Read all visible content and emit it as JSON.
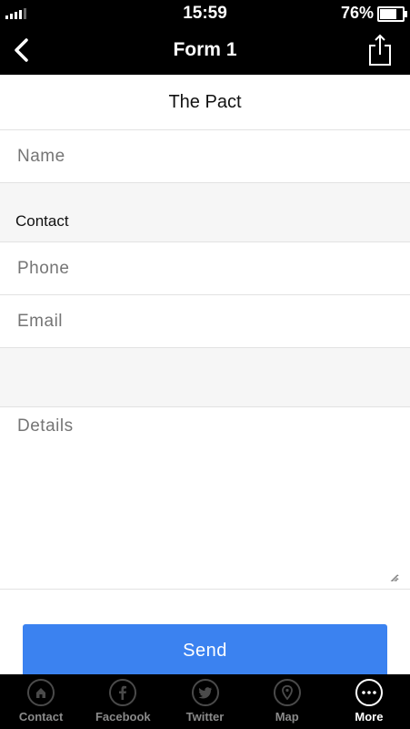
{
  "status_bar": {
    "time": "15:59",
    "battery": "76%",
    "battery_level": 0.76
  },
  "nav": {
    "title": "Form 1"
  },
  "form": {
    "heading": "The Pact",
    "name_label": "Name",
    "contact_section": "Contact",
    "phone_label": "Phone",
    "email_label": "Email",
    "details_label": "Details",
    "send_label": "Send"
  },
  "tabs": [
    {
      "label": "Contact",
      "icon": "home-icon"
    },
    {
      "label": "Facebook",
      "icon": "facebook-icon"
    },
    {
      "label": "Twitter",
      "icon": "twitter-icon"
    },
    {
      "label": "Map",
      "icon": "map-pin-icon"
    },
    {
      "label": "More",
      "icon": "more-icon",
      "active": true
    }
  ],
  "colors": {
    "accent": "#3b82f0",
    "bar": "#000000",
    "section_bg": "#f6f6f6"
  }
}
